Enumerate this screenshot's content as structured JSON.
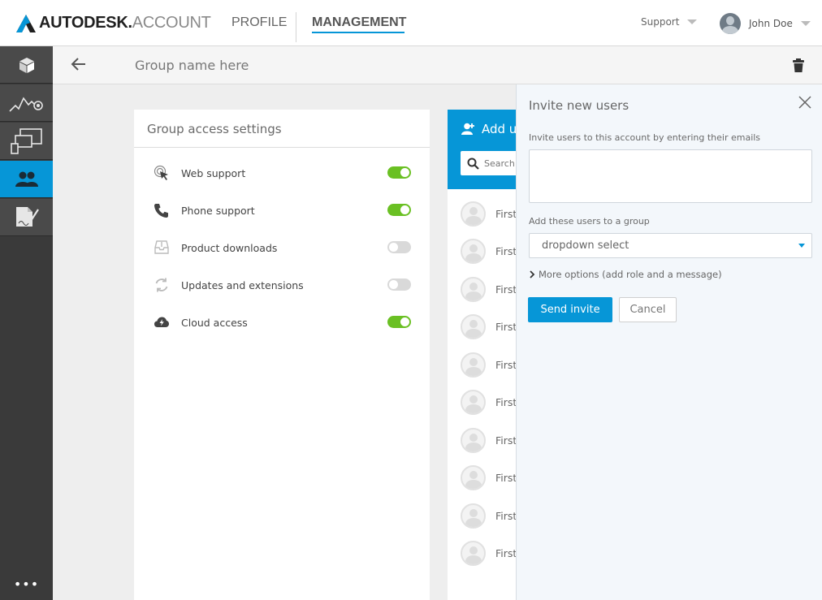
{
  "header": {
    "brand": "AUTODESK.",
    "product": "ACCOUNT",
    "nav": {
      "profile": "PROFILE",
      "management": "MANAGEMENT"
    },
    "support_label": "Support",
    "user_name": "John Doe"
  },
  "rail": {
    "items": [
      {
        "icon": "cube-icon"
      },
      {
        "icon": "usage-chart-icon"
      },
      {
        "icon": "devices-icon"
      },
      {
        "icon": "users-icon",
        "active": true
      },
      {
        "icon": "contract-icon"
      }
    ],
    "more": "•••"
  },
  "subheader": {
    "title": "Group name here"
  },
  "group_access": {
    "title": "Group access settings",
    "settings": [
      {
        "label": "Web support",
        "icon": "cursor-click-icon",
        "enabled": true
      },
      {
        "label": "Phone support",
        "icon": "phone-icon",
        "enabled": true
      },
      {
        "label": "Product downloads",
        "icon": "download-tray-icon",
        "enabled": false
      },
      {
        "label": "Updates and extensions",
        "icon": "refresh-icon",
        "enabled": false
      },
      {
        "label": "Cloud access",
        "icon": "cloud-bolt-icon",
        "enabled": true
      }
    ]
  },
  "users_panel": {
    "add_label": "Add u",
    "search_placeholder": "Search",
    "rows": [
      "First",
      "First",
      "First",
      "First",
      "First",
      "First",
      "First",
      "First",
      "First",
      "First"
    ]
  },
  "invite": {
    "title": "Invite new users",
    "email_label": "Invite users to this account by entering their emails",
    "email_value": "",
    "group_label": "Add these users to a group",
    "group_select": "dropdown select",
    "more_options": "More options (add role and a message)",
    "send_label": "Send invite",
    "cancel_label": "Cancel"
  },
  "colors": {
    "accent": "#0696d7",
    "toggle_on": "#6ac023",
    "toggle_off": "#d9d9d9",
    "rail_bg": "#3a3a3a"
  }
}
